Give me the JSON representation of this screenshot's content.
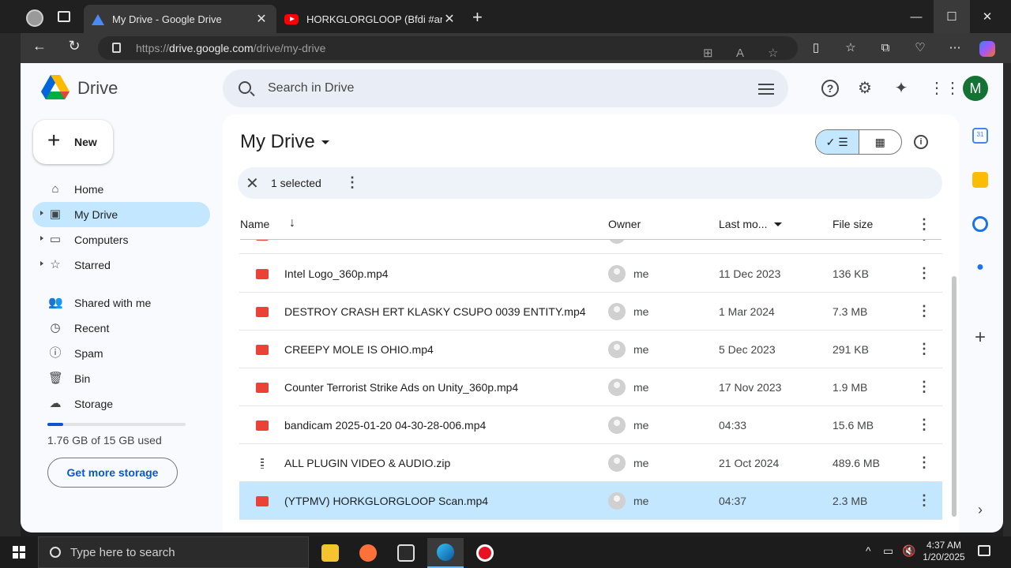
{
  "browser": {
    "tabs": [
      {
        "title": "My Drive - Google Drive",
        "favicon": "drive-icon",
        "active": true
      },
      {
        "title": "HORKGLORGLOOP (Bfdi #animati",
        "favicon": "youtube-icon",
        "active": false
      }
    ],
    "url_prefix": "https://",
    "url_domain": "drive.google.com",
    "url_path": "/drive/my-drive",
    "window_controls": {
      "minimize": "—",
      "maximize": "☐",
      "close": "✕"
    }
  },
  "drive": {
    "logo_text": "Drive",
    "search_placeholder": "Search in Drive",
    "avatar_letter": "M",
    "new_button_label": "New",
    "nav": [
      {
        "label": "Home",
        "icon": "home-icon"
      },
      {
        "label": "My Drive",
        "icon": "my-drive-icon",
        "active": true,
        "expandable": true
      },
      {
        "label": "Computers",
        "icon": "computers-icon",
        "expandable": true
      },
      {
        "label": "Starred",
        "icon": "star-icon",
        "expandable": true
      },
      {
        "label": "Shared with me",
        "icon": "shared-icon"
      },
      {
        "label": "Recent",
        "icon": "clock-icon"
      },
      {
        "label": "Spam",
        "icon": "spam-icon"
      },
      {
        "label": "Bin",
        "icon": "trash-icon"
      },
      {
        "label": "Storage",
        "icon": "cloud-icon"
      }
    ],
    "storage": {
      "used_text": "1.76 GB of 15 GB used",
      "fraction": 0.117,
      "get_more_label": "Get more storage"
    },
    "page_title": "My Drive",
    "selection": {
      "count_text": "1 selected"
    },
    "columns": {
      "name": "Name",
      "owner": "Owner",
      "modified": "Last mo...",
      "size": "File size"
    },
    "files": [
      {
        "name": "Intel Logo_360p.mp4",
        "type": "video",
        "owner": "me",
        "modified": "11 Dec 2023",
        "size": "136 KB"
      },
      {
        "name": "DESTROY CRASH ERT KLASKY CSUPO 0039 ENTITY.mp4",
        "type": "video",
        "owner": "me",
        "modified": "1 Mar 2024",
        "size": "7.3 MB"
      },
      {
        "name": "CREEPY MOLE IS OHIO.mp4",
        "type": "video",
        "owner": "me",
        "modified": "5 Dec 2023",
        "size": "291 KB"
      },
      {
        "name": "Counter Terrorist Strike Ads on Unity_360p.mp4",
        "type": "video",
        "owner": "me",
        "modified": "17 Nov 2023",
        "size": "1.9 MB"
      },
      {
        "name": "bandicam 2025-01-20 04-30-28-006.mp4",
        "type": "video",
        "owner": "me",
        "modified": "04:33",
        "size": "15.6 MB"
      },
      {
        "name": "ALL PLUGIN VIDEO & AUDIO.zip",
        "type": "zip",
        "owner": "me",
        "modified": "21 Oct 2024",
        "size": "489.6 MB"
      },
      {
        "name": "(YTPMV) HORKGLORGLOOP Scan.mp4",
        "type": "video",
        "owner": "me",
        "modified": "04:37",
        "size": "2.3 MB",
        "selected": true
      }
    ]
  },
  "taskbar": {
    "search_placeholder": "Type here to search",
    "time": "4:37 AM",
    "date": "1/20/2025"
  },
  "colors": {
    "accent": "#c2e7ff",
    "brand_blue": "#0b57d0",
    "avatar_green": "#137333",
    "video_red": "#ea4335"
  }
}
